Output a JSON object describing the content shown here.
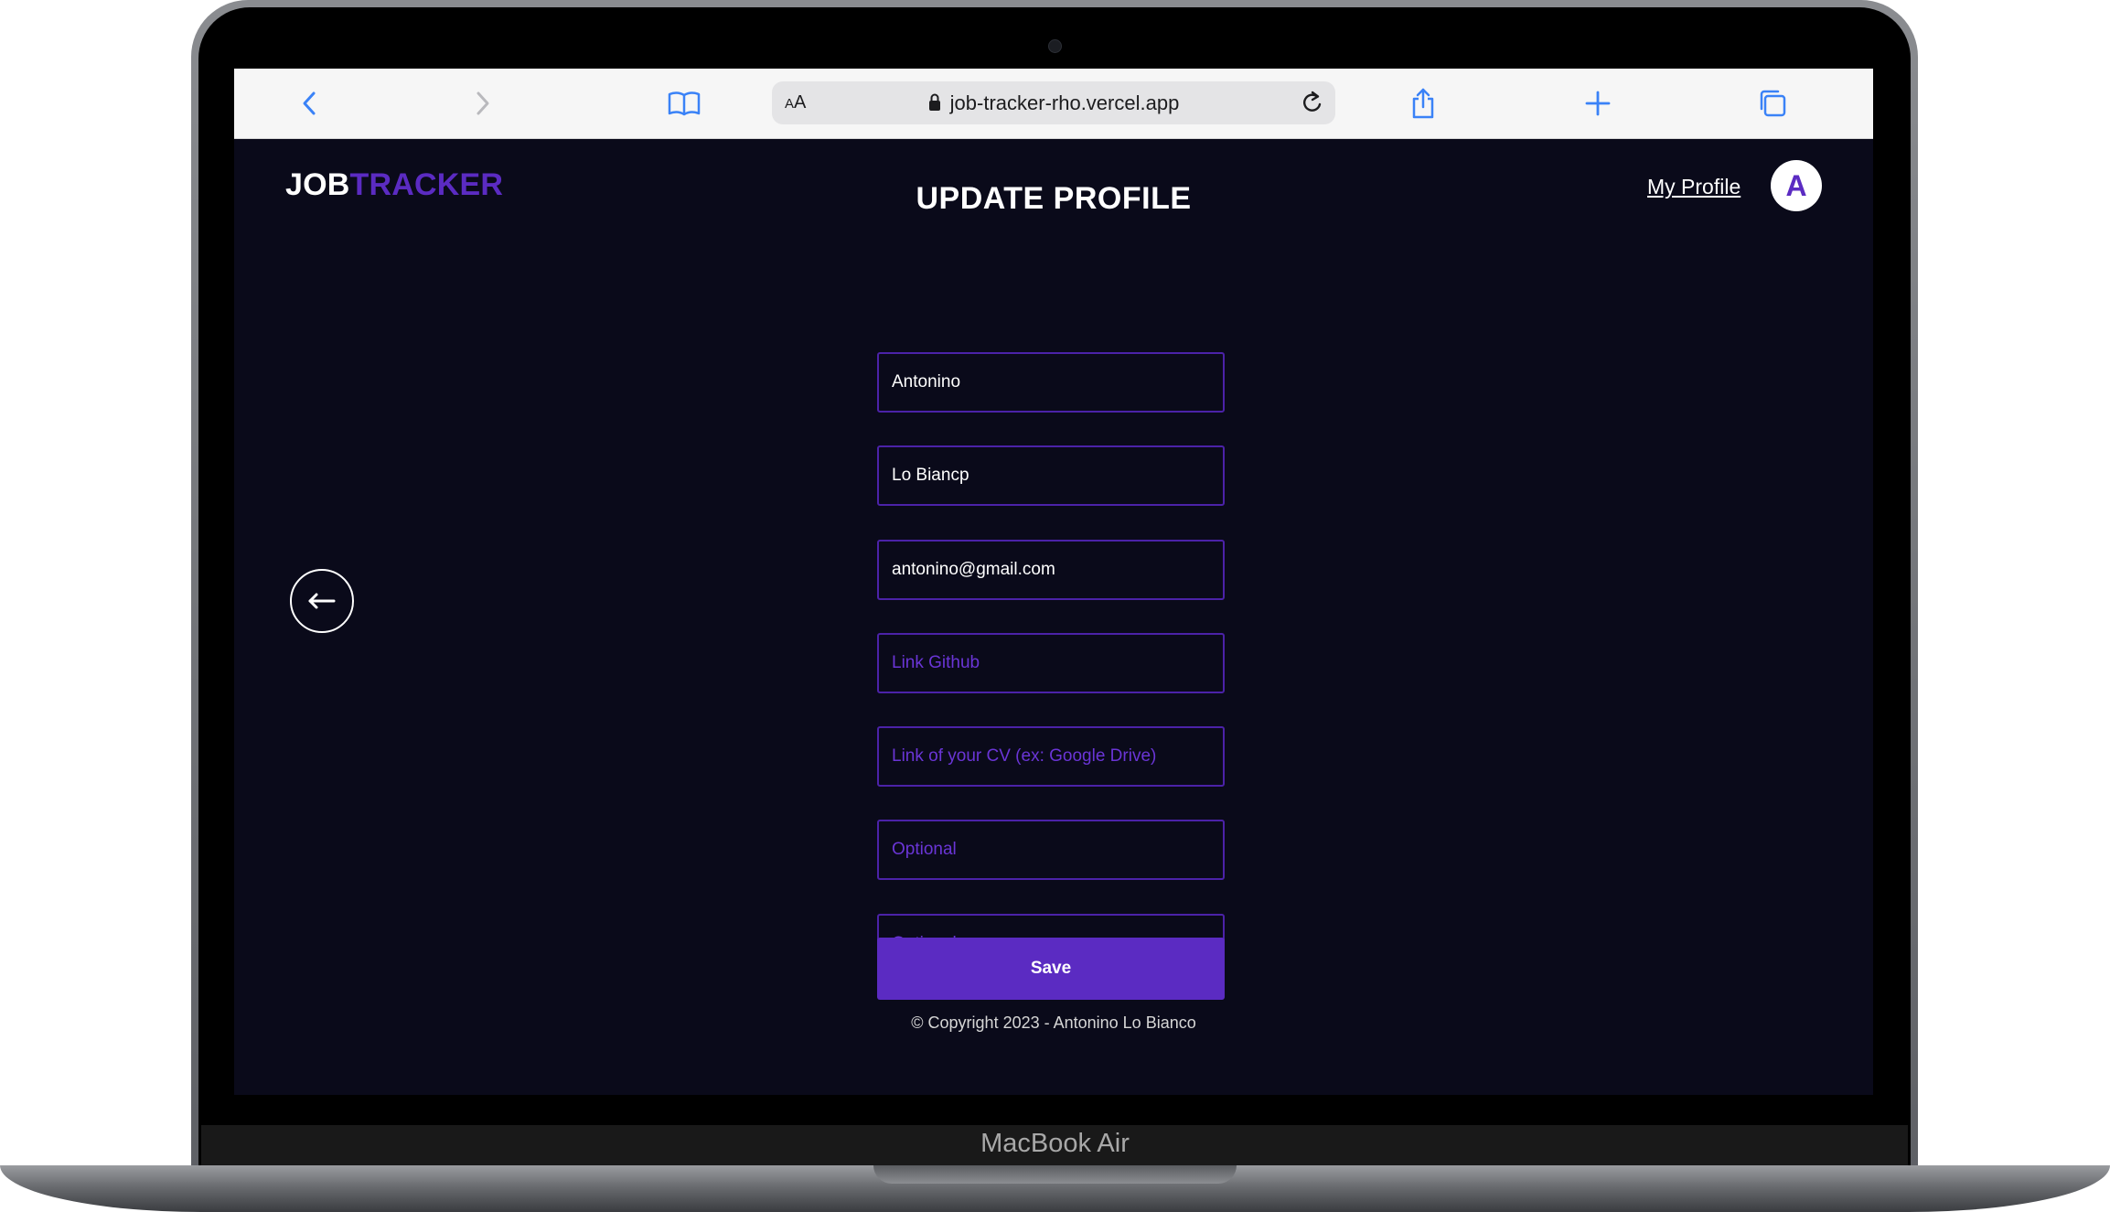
{
  "device": {
    "label": "MacBook Air"
  },
  "browser": {
    "text_size_label": "AA",
    "url": "job-tracker-rho.vercel.app",
    "icons": [
      "chevron-left-icon",
      "chevron-right-icon",
      "book-icon",
      "lock-icon",
      "reload-icon",
      "share-icon",
      "plus-icon",
      "tabs-icon"
    ],
    "accent": "#3a82f7"
  },
  "header": {
    "logo_part1": "JOB",
    "logo_part2": "TRACKER",
    "title": "UPDATE PROFILE",
    "profile_link": "My Profile",
    "avatar_initial": "A"
  },
  "form": {
    "first_name": {
      "value": "Antonino",
      "placeholder": ""
    },
    "last_name": {
      "value": "Lo Biancp",
      "placeholder": ""
    },
    "email": {
      "value": "antonino@gmail.com",
      "placeholder": ""
    },
    "github": {
      "value": "",
      "placeholder": "Link Github"
    },
    "cv": {
      "value": "",
      "placeholder": "Link of your CV (ex: Google Drive)"
    },
    "optional_1": {
      "value": "",
      "placeholder": "Optional"
    },
    "optional_2": {
      "value": "",
      "placeholder": "Optional"
    },
    "save_label": "Save"
  },
  "footer": {
    "copyright": "© Copyright 2023 - Antonino Lo Bianco"
  },
  "colors": {
    "brand": "#5b2bc2",
    "background": "#0a0a1a",
    "text": "#ffffff"
  }
}
